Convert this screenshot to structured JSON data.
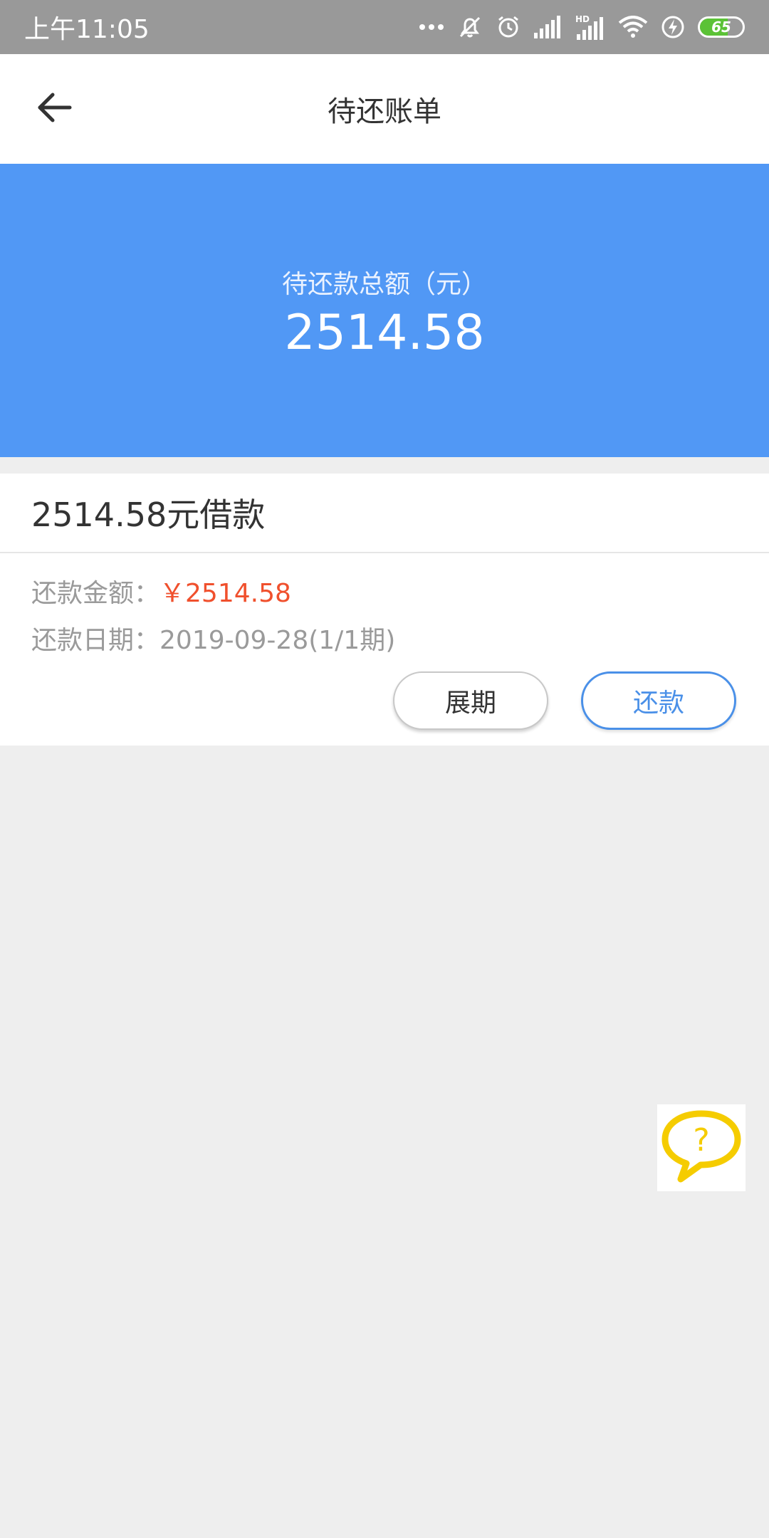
{
  "status_bar": {
    "time": "上午11:05",
    "battery_level": "65",
    "battery_fraction": 0.65,
    "icons": [
      "more-dots-icon",
      "mute-icon",
      "alarm-icon",
      "signal-icon",
      "hd-signal-icon",
      "wifi-icon",
      "charging-icon",
      "battery-icon"
    ]
  },
  "header": {
    "title": "待还账单",
    "back_icon": "arrow-left-icon"
  },
  "summary": {
    "label": "待还款总额（元）",
    "amount": "2514.58",
    "background_color": "#5198f5"
  },
  "loan": {
    "title": "2514.58元借款",
    "amount_label": "还款金额：",
    "amount_value": "￥2514.58",
    "amount_color": "#f0502d",
    "date_label": "还款日期：",
    "date_value": "2019-09-28(1/1期)",
    "extend_label": "展期",
    "repay_label": "还款",
    "accent_color": "#4a90e8"
  },
  "help": {
    "icon": "question-chat-icon",
    "icon_color": "#f5cc00"
  }
}
